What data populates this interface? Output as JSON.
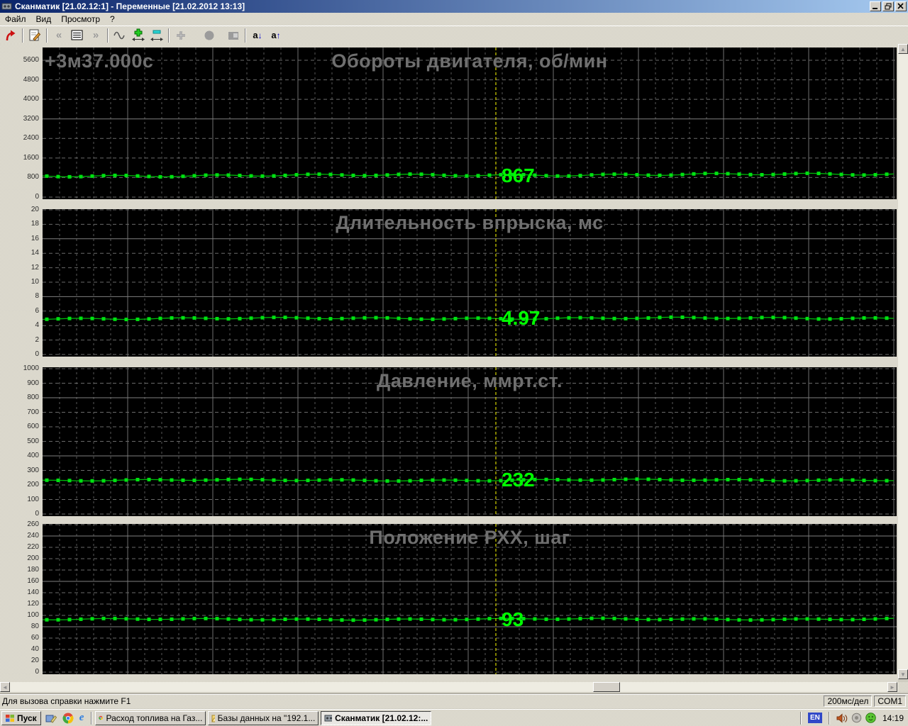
{
  "window": {
    "title": "Сканматик [21.02.12:1] - Переменные [21.02.2012  13:13]"
  },
  "menu": {
    "items": [
      "Файл",
      "Вид",
      "Просмотр",
      "?"
    ]
  },
  "toolbar": {
    "glyphs": {
      "prev": "«",
      "next": "»",
      "letter": "a",
      "arrow_down": "↓",
      "arrow_up": "↑"
    }
  },
  "cursor": {
    "label": "+3м37.000с"
  },
  "chart_data": [
    {
      "type": "line",
      "title": "Обороты двигателя, об/мин",
      "ylabel": "об/мин",
      "ylim": [
        0,
        5600
      ],
      "ytick_step": 800,
      "yticks": [
        5600,
        4800,
        4000,
        3200,
        2400,
        1600,
        800,
        0
      ],
      "x_scale_per_div": "200мс/дел",
      "grid": "dashed, solid every 4th division",
      "cursor_value": 867,
      "cursor_value_label": "867",
      "series": [
        {
          "name": "Обороты двигателя",
          "shape": "approximately constant",
          "value": 867
        }
      ]
    },
    {
      "type": "line",
      "title": "Длительность впрыска, мс",
      "ylabel": "мс",
      "ylim": [
        0,
        20
      ],
      "ytick_step": 2,
      "yticks": [
        20,
        18,
        16,
        14,
        12,
        10,
        8,
        6,
        4,
        2,
        0
      ],
      "x_scale_per_div": "200мс/дел",
      "grid": "dashed, solid every 4th division",
      "cursor_value": 4.97,
      "cursor_value_label": "4.97",
      "series": [
        {
          "name": "Длительность впрыска",
          "shape": "approximately constant",
          "value": 4.97
        }
      ]
    },
    {
      "type": "line",
      "title": "Давление, ммрт.ст.",
      "ylabel": "ммрт.ст.",
      "ylim": [
        0,
        1000
      ],
      "ytick_step": 100,
      "yticks": [
        1000,
        900,
        800,
        700,
        600,
        500,
        400,
        300,
        200,
        100,
        0
      ],
      "x_scale_per_div": "200мс/дел",
      "grid": "dashed, solid every 4th division",
      "cursor_value": 232,
      "cursor_value_label": "232",
      "series": [
        {
          "name": "Давление",
          "shape": "approximately constant",
          "value": 232
        }
      ]
    },
    {
      "type": "line",
      "title": "Положение РХХ, шаг",
      "ylabel": "шаг",
      "ylim": [
        0,
        260
      ],
      "ytick_step": 20,
      "yticks": [
        260,
        240,
        220,
        200,
        180,
        160,
        140,
        120,
        100,
        80,
        60,
        40,
        20,
        0
      ],
      "x_scale_per_div": "200мс/дел",
      "grid": "dashed, solid every 4th division",
      "cursor_value": 93,
      "cursor_value_label": "93",
      "series": [
        {
          "name": "Положение РХХ",
          "shape": "approximately constant",
          "value": 93
        }
      ]
    }
  ],
  "colors": {
    "trace": "#00e112",
    "value_text": "#00ff00",
    "cursor_line": "#ffff00",
    "chart_title": "#6f6f6f",
    "chart_bg": "#000000",
    "titlebar_start": "#0a246a",
    "titlebar_end": "#a6caf0"
  },
  "status_bar": {
    "help_text": "Для вызова справки нажмите F1",
    "time_scale": "200мс/дел",
    "port": "COM1"
  },
  "taskbar": {
    "start_label": "Пуск",
    "buttons": [
      {
        "icon": "chrome-icon",
        "label": "Расход топлива на Газ...",
        "active": false
      },
      {
        "icon": "folder-icon",
        "label": "Базы данных на \"192.1...",
        "active": false
      },
      {
        "icon": "scanmatic-icon",
        "label": "Сканматик [21.02.12:...",
        "active": true
      }
    ],
    "tray": {
      "lang": "EN",
      "clock": "14:19"
    }
  }
}
